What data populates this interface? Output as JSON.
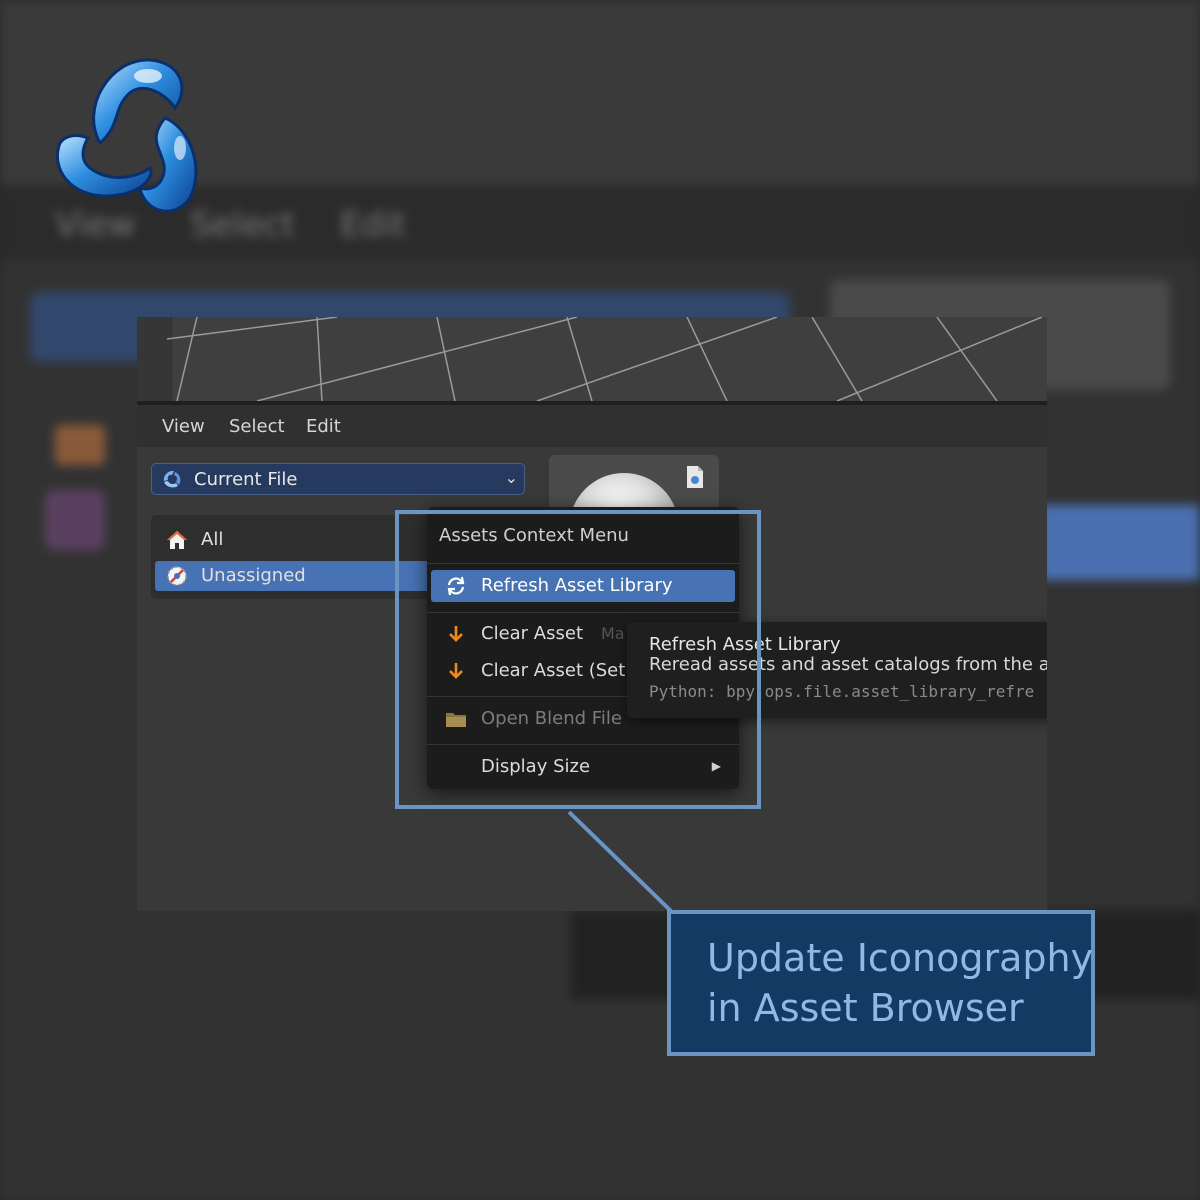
{
  "colors": {
    "accent_blue": "#4772b3",
    "callout_bg": "#133a63",
    "callout_border": "#6a94c4",
    "callout_text": "#8fb8e6",
    "panel_bg": "#393939",
    "menu_bg": "#1c1c1c",
    "icon_orange": "#f08a1c"
  },
  "logo": {
    "icon": "blender-community-logo-icon"
  },
  "header": {
    "menu": [
      "View",
      "Select",
      "Edit"
    ]
  },
  "library_selector": {
    "icon": "asset-library-icon",
    "value": "Current File",
    "chevron": "chevron-down-icon"
  },
  "catalogs": [
    {
      "label": "All",
      "icon": "home-icon",
      "selected": false
    },
    {
      "label": "Unassigned",
      "icon": "unassigned-icon",
      "selected": true
    }
  ],
  "context_menu": {
    "title": "Assets Context Menu",
    "items": [
      {
        "label": "Refresh Asset Library",
        "icon": "refresh-icon",
        "highlighted": true
      },
      {
        "label": "Clear Asset",
        "icon": "arrow-down-icon",
        "ghost": "Ma"
      },
      {
        "label": "Clear Asset (Set Fa",
        "icon": "arrow-down-icon"
      },
      {
        "label": "Open Blend File",
        "icon": "folder-icon",
        "disabled": true
      },
      {
        "label": "Display Size",
        "icon": "",
        "submenu": true
      }
    ]
  },
  "tooltip": {
    "title": "Refresh Asset Library",
    "description": "Reread assets and asset catalogs from the asset",
    "python": "Python: bpy.ops.file.asset_library_refre"
  },
  "callout": {
    "line1": "Update Iconography",
    "line2": "in Asset Browser"
  },
  "background_blur": {
    "menu": [
      "View",
      "Select",
      "Edit"
    ]
  }
}
